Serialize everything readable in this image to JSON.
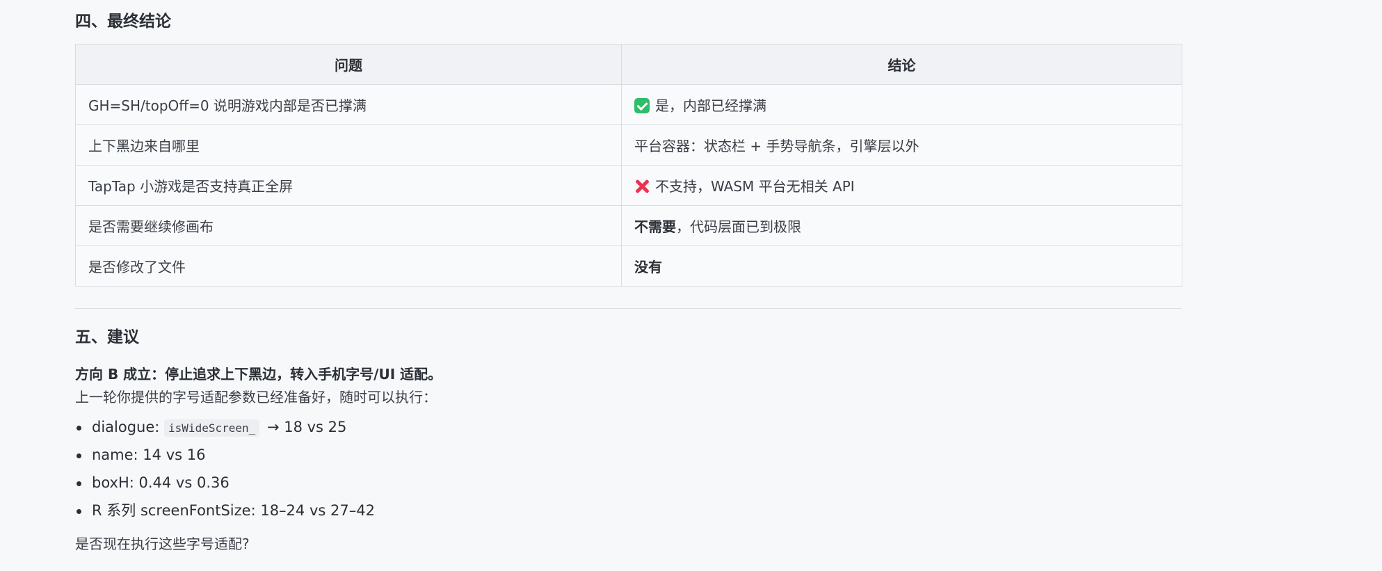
{
  "section4": {
    "title": "四、最终结论",
    "table": {
      "headers": [
        "问题",
        "结论"
      ],
      "rows": [
        {
          "question": "GH=SH/topOff=0 说明游戏内部是否已撑满",
          "icon": "check-icon",
          "answer": "是，内部已经撑满",
          "answer_bold": "",
          "answer_rest": ""
        },
        {
          "question": "上下黑边来自哪里",
          "icon": "",
          "answer": "平台容器：状态栏 + 手势导航条，引擎层以外",
          "answer_bold": "",
          "answer_rest": ""
        },
        {
          "question": "TapTap 小游戏是否支持真正全屏",
          "icon": "cross-icon",
          "answer": "不支持，WASM 平台无相关 API",
          "answer_bold": "",
          "answer_rest": ""
        },
        {
          "question": "是否需要继续修画布",
          "icon": "",
          "answer": "",
          "answer_bold": "不需要",
          "answer_rest": "，代码层面已到极限"
        },
        {
          "question": "是否修改了文件",
          "icon": "",
          "answer": "",
          "answer_bold": "没有",
          "answer_rest": ""
        }
      ]
    }
  },
  "section5": {
    "title": "五、建议",
    "lead": "方向 B 成立：停止追求上下黑边，转入手机字号/UI 适配。",
    "paragraph": "上一轮你提供的字号适配参数已经准备好，随时可以执行：",
    "bullets": [
      {
        "prefix": "dialogue: ",
        "code": "isWideScreen_",
        "suffix": " → 18 vs 25"
      },
      {
        "prefix": "name: 14 vs 16",
        "code": "",
        "suffix": ""
      },
      {
        "prefix": "boxH: 0.44 vs 0.36",
        "code": "",
        "suffix": ""
      },
      {
        "prefix": "R 系列 screenFontSize: 18–24 vs 27–42",
        "code": "",
        "suffix": ""
      }
    ],
    "question": "是否现在执行这些字号适配?"
  },
  "colors": {
    "background": "#f7f8fa",
    "check": "#2ebd6a",
    "cross": "#e8344f",
    "border": "#d9dce1"
  }
}
